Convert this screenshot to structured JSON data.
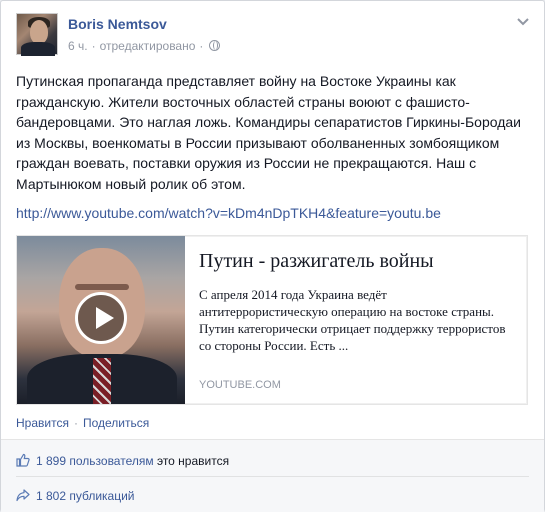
{
  "post": {
    "author": "Boris Nemtsov",
    "time": "6 ч.",
    "separator": "·",
    "edited": "отредактировано",
    "text": "Путинская пропаганда представляет войну на Востоке Украины как гражданскую. Жители восточных областей страны воюют с фашисто-бандеровцами. Это наглая ложь. Командиры сепаратистов Гиркины-Бородаи из Москвы, военкоматы в России призывают оболваненных зомбоящиком граждан воевать, поставки оружия из России не прекращаются. Наш с Мартынюком новый ролик об этом.",
    "link": "http://www.youtube.com/watch?v=kDm4nDpTKH4&feature=youtu.be"
  },
  "share": {
    "title": "Путин - разжигатель войны",
    "description": "С апреля 2014 года Украина ведёт антитеррористическую операцию на востоке страны. Путин категорически отрицает поддержку террористов со стороны России. Есть ...",
    "source": "YOUTUBE.COM"
  },
  "actions": {
    "like": "Нравится",
    "separator": "·",
    "share": "Поделиться"
  },
  "stats": {
    "likes_count": "1 899 пользователям",
    "likes_rest": "это нравится",
    "shares_count": "1 802 публикаций"
  },
  "icons": {
    "privacy": "globe-icon",
    "menu": "chevron-down-icon",
    "like": "thumbs-up-icon",
    "share": "share-arrow-icon",
    "video": "play-icon"
  },
  "colors": {
    "link": "#3b5998",
    "meta": "#9197a3",
    "text": "#141823"
  }
}
